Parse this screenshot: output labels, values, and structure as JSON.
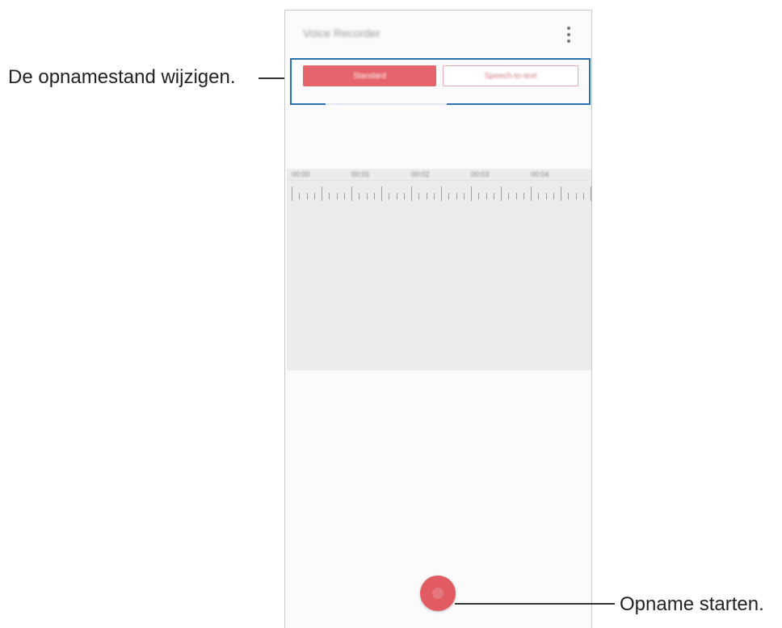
{
  "annotations": {
    "mode_callout": "De opnamestand wijzigen.",
    "record_callout": "Opname starten."
  },
  "app": {
    "title": "Voice Recorder",
    "menu_icon": "more-vertical-icon"
  },
  "modes": {
    "standard_label": "Standard",
    "interview_label": "Speech-to-text"
  },
  "timeline": {
    "tick_labels": [
      "00:00",
      "00:01",
      "00:02",
      "00:03",
      "00:04"
    ]
  },
  "record": {
    "icon": "record-icon",
    "color": "#e25a62"
  },
  "colors": {
    "accent": "#e5636a",
    "highlight": "#2a6fb0"
  }
}
